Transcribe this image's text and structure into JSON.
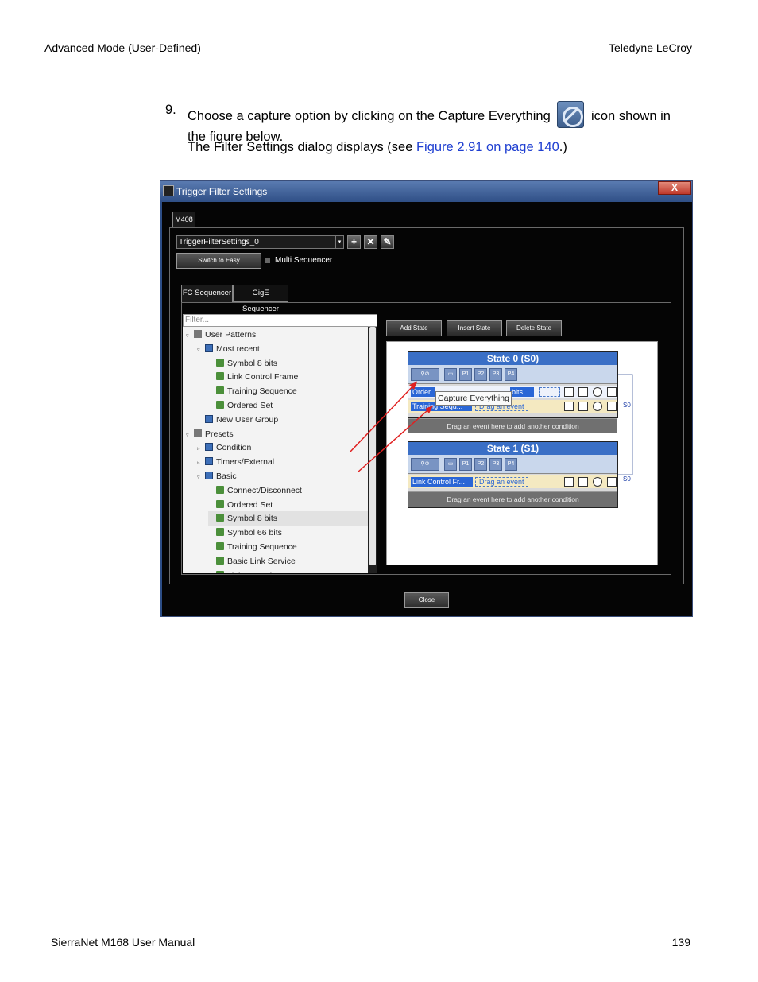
{
  "header": {
    "left": "Advanced Mode (User-Defined)",
    "right": "Teledyne  LeCroy"
  },
  "step": {
    "number": "9.",
    "text_before_icon": "Choose a capture option by clicking on the Capture Everything",
    "icon": "capture-everything-icon",
    "text_after_icon": "icon shown in the figure below.",
    "result_prefix": "The Filter Settings dialog displays (see ",
    "result_link": "Figure 2.91 on page 140",
    "result_suffix": ".)"
  },
  "screenshot": {
    "title": "Trigger Filter Settings",
    "close_glyph": "X",
    "device_tab": "M408",
    "settings_combo": "TriggerFilterSettings_0",
    "combo_arrow": "▾",
    "combo_buttons": [
      "+",
      "✕",
      "✎"
    ],
    "switch_button": "Switch to Easy",
    "multi_sequencer_label": "Multi Sequencer",
    "tabs": [
      "FC Sequencer",
      "GigE Sequencer"
    ],
    "filter_placeholder": "Filter...",
    "tree": [
      {
        "label": "User Patterns",
        "level": 0,
        "type": "list",
        "expanded": true
      },
      {
        "label": "Most recent",
        "level": 1,
        "type": "folder",
        "expanded": true
      },
      {
        "label": "Symbol 8 bits",
        "level": 2,
        "type": "leaf"
      },
      {
        "label": "Link Control Frame",
        "level": 2,
        "type": "leaf"
      },
      {
        "label": "Training Sequence",
        "level": 2,
        "type": "leaf"
      },
      {
        "label": "Ordered Set",
        "level": 2,
        "type": "leaf"
      },
      {
        "label": "New User Group",
        "level": 1,
        "type": "folder"
      },
      {
        "label": "Presets",
        "level": 0,
        "type": "list",
        "expanded": true
      },
      {
        "label": "Condition",
        "level": 1,
        "type": "folder",
        "collapsed": true
      },
      {
        "label": "Timers/External",
        "level": 1,
        "type": "folder",
        "collapsed": true
      },
      {
        "label": "Basic",
        "level": 1,
        "type": "folder",
        "expanded": true
      },
      {
        "label": "Connect/Disconnect",
        "level": 2,
        "type": "leaf"
      },
      {
        "label": "Ordered Set",
        "level": 2,
        "type": "leaf"
      },
      {
        "label": "Symbol 8 bits",
        "level": 2,
        "type": "leaf",
        "selected": true
      },
      {
        "label": "Symbol 66 bits",
        "level": 2,
        "type": "leaf"
      },
      {
        "label": "Training Sequence",
        "level": 2,
        "type": "leaf"
      },
      {
        "label": "Basic Link Service",
        "level": 2,
        "type": "leaf"
      },
      {
        "label": "Link Control F...",
        "level": 2,
        "type": "leaf"
      }
    ],
    "toolbar": [
      "Add State",
      "Insert State",
      "Delete State"
    ],
    "state0": {
      "title": "State 0 (S0)",
      "pattern_buttons": [
        "P1",
        "P2",
        "P3",
        "P4"
      ],
      "row1_chip": "Order",
      "row1_chip2": "bits",
      "row2_chip": "Training Sequ...",
      "row2_drag": "Drag an event",
      "drag_condition": "Drag an event here to add another condition",
      "goto": "S0"
    },
    "state1": {
      "title": "State 1 (S1)",
      "pattern_buttons": [
        "P1",
        "P2",
        "P3",
        "P4"
      ],
      "row1_chip": "Link Control Fr...",
      "row1_drag": "Drag an event",
      "drag_condition": "Drag an event here to add another condition",
      "goto": "S0"
    },
    "tooltip": "Capture Everything",
    "close_button": "Close"
  },
  "footer": {
    "left": "SierraNet M168 User Manual",
    "right": "139"
  },
  "colors": {
    "link": "#1f3fd1",
    "arrow": "#e02020",
    "state_title": "#3a6fc6"
  }
}
